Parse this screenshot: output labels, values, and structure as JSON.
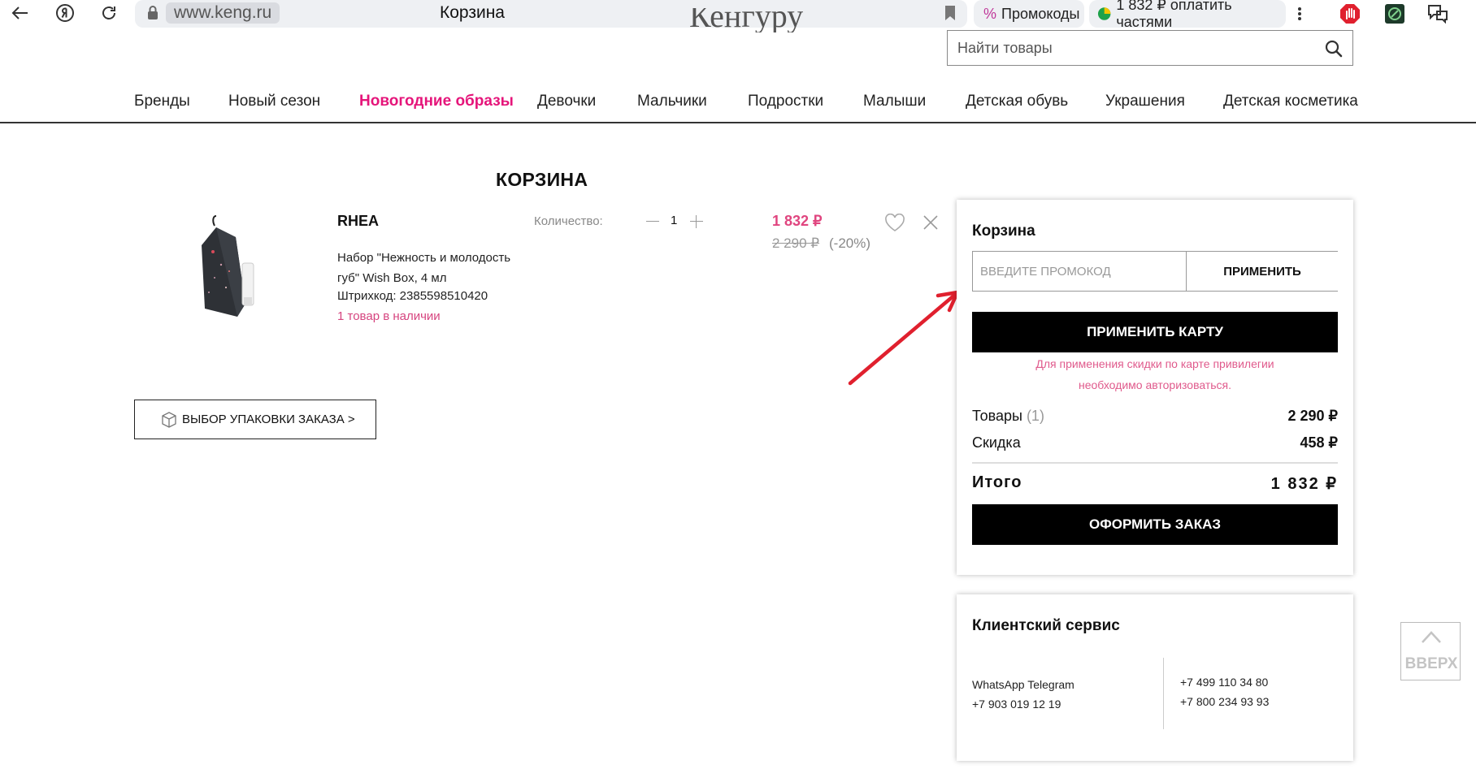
{
  "browser": {
    "domain": "www.keng.ru",
    "tab_title": "Корзина",
    "promo_chip": "Промокоды",
    "installment_chip": "1 832 ₽ оплатить частями"
  },
  "header": {
    "logo_fragment": "Кенгуру",
    "search_placeholder": "Найти товары"
  },
  "nav": {
    "items": [
      {
        "label": "Бренды"
      },
      {
        "label": "Новый сезон"
      },
      {
        "label": "Новогодние образы",
        "active": true
      },
      {
        "label": "Девочки"
      },
      {
        "label": "Мальчики"
      },
      {
        "label": "Подростки"
      },
      {
        "label": "Малыши"
      },
      {
        "label": "Детская обувь"
      },
      {
        "label": "Украшения"
      },
      {
        "label": "Детская косметика"
      }
    ]
  },
  "cart": {
    "heading": "КОРЗИНА",
    "item": {
      "brand": "RHEA",
      "description": "Набор \"Нежность и молодость губ\" Wish Box, 4 мл",
      "sku": "Штрихкод: 2385598510420",
      "stock": "1 товар в наличии",
      "quantity_label": "Количество:",
      "quantity": "1",
      "price": "1 832 ₽",
      "old_price": "2 290 ₽",
      "discount": "(-20%)"
    },
    "packaging_button": "ВЫБОР УПАКОВКИ ЗАКАЗА >"
  },
  "summary": {
    "title": "Корзина",
    "promo_placeholder": "ВВЕДИТЕ ПРОМОКОД",
    "apply_label": "ПРИМЕНИТЬ",
    "apply_card_label": "ПРИМЕНИТЬ КАРТУ",
    "card_note_1": "Для применения скидки по карте привилегии",
    "card_note_2": "необходимо авторизоваться.",
    "goods_label": "Товары",
    "goods_count": "(1)",
    "goods_value": "2 290 ₽",
    "discount_label": "Скидка",
    "discount_value": "458 ₽",
    "total_label": "Итого",
    "total_value": "1 832 ₽",
    "checkout_label": "ОФОРМИТЬ ЗАКАЗ"
  },
  "service": {
    "title": "Клиентский сервис",
    "messengers": "WhatsApp Telegram",
    "messenger_phone": "+7 903 019 12 19",
    "phone_1": "+7 499 110 34 80",
    "phone_2": "+7 800 234 93 93"
  },
  "up_button": "ВВЕРХ",
  "colors": {
    "accent_pink": "#e5157a",
    "price_pink": "#e0457f",
    "annotation_red": "#e0202e"
  }
}
